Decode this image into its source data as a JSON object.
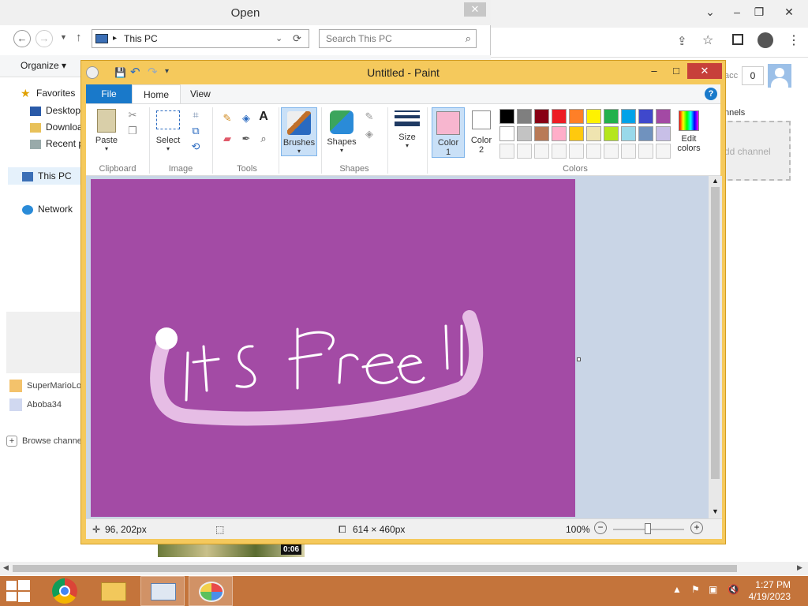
{
  "open_dialog": {
    "title": "Open",
    "close": "✕",
    "location": "This PC",
    "search_placeholder": "Search This PC",
    "organize": "Organize ▾",
    "tree": [
      "Favorites",
      "Desktop",
      "Downloads",
      "Recent places",
      "This PC",
      "Network"
    ]
  },
  "browser": {
    "channels": [
      {
        "name": "SuperMarioLogan"
      },
      {
        "name": "Aboba34"
      }
    ],
    "browse_channels": "Browse channels",
    "account_badge": "0",
    "acc_fragment": "acc",
    "channels_fragment": "nnels",
    "add_channel": "dd channel",
    "video_duration": "0:06"
  },
  "paint": {
    "title": "Untitled - Paint",
    "tabs": {
      "file": "File",
      "home": "Home",
      "view": "View"
    },
    "groups": {
      "clipboard": "Clipboard",
      "image": "Image",
      "tools": "Tools",
      "shapes": "Shapes",
      "colors": "Colors"
    },
    "buttons": {
      "paste": "Paste",
      "select": "Select",
      "brushes": "Brushes",
      "shapes": "Shapes",
      "size": "Size",
      "color1": "Color",
      "color1_num": "1",
      "color2": "Color",
      "color2_num": "2",
      "edit_colors": "Edit",
      "edit_colors_2": "colors"
    },
    "palette": [
      "#000000",
      "#7f7f7f",
      "#880015",
      "#ed1c24",
      "#ff7f27",
      "#fff200",
      "#22b14c",
      "#00a2e8",
      "#3f48cc",
      "#a349a4",
      "#ffffff",
      "#c3c3c3",
      "#b97a57",
      "#ffaec9",
      "#ffc90e",
      "#efe4b0",
      "#b5e61d",
      "#99d9ea",
      "#7092be",
      "#c8bfe7",
      "#f5f5f5",
      "#f5f5f5",
      "#f5f5f5",
      "#f5f5f5",
      "#f5f5f5",
      "#f5f5f5",
      "#f5f5f5",
      "#f5f5f5",
      "#f5f5f5",
      "#f5f5f5"
    ],
    "color1_value": "#f7b6cf",
    "color2_value": "#ffffff",
    "canvas_color": "#a34ba5",
    "canvas_text": "its free !!",
    "status": {
      "cursor_pos": "96, 202px",
      "image_size": "614 × 460px",
      "zoom": "100%"
    }
  },
  "taskbar": {
    "time": "1:27 PM",
    "date": "4/19/2023"
  }
}
